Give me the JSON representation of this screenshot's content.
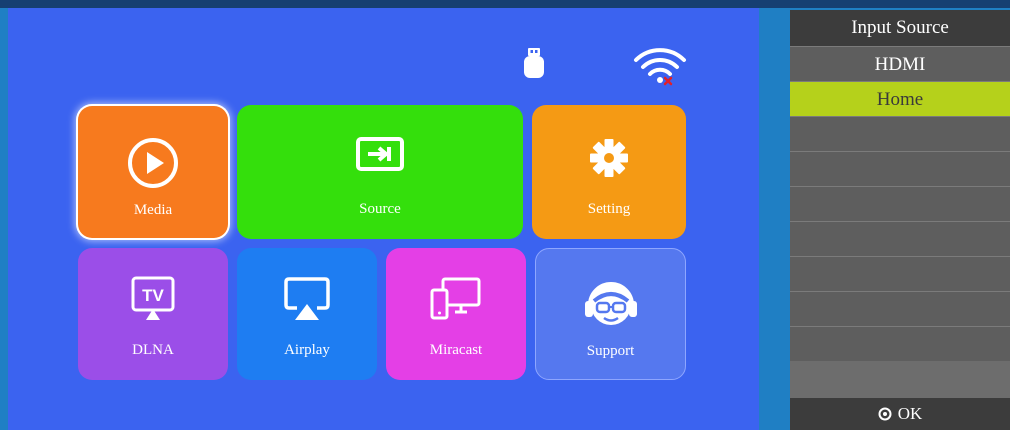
{
  "status_bar": {
    "usb_icon": "usb-drive-icon",
    "wifi_icon": "wifi-disconnected-icon",
    "wifi_alert_color": "#e0202a"
  },
  "tiles": [
    {
      "label": "Media",
      "icon": "play-icon",
      "color": "#f77a1e",
      "focused": true
    },
    {
      "label": "Source",
      "icon": "input-source-icon",
      "color": "#34df0c"
    },
    {
      "label": "Setting",
      "icon": "gear-icon",
      "color": "#f59a14"
    },
    {
      "label": "DLNA",
      "icon": "tv-cast-icon",
      "color": "#9b4ee8"
    },
    {
      "label": "Airplay",
      "icon": "airplay-icon",
      "color": "#1e7df2"
    },
    {
      "label": "Miracast",
      "icon": "devices-icon",
      "color": "#e43fe6"
    },
    {
      "label": "Support",
      "icon": "support-headset-icon",
      "color": "#5578ef"
    }
  ],
  "osd": {
    "title": "Input Source",
    "items": [
      {
        "label": "HDMI",
        "selected": false
      },
      {
        "label": "Home",
        "selected": true
      }
    ],
    "footer_label": "OK",
    "footer_icon": "ok-button-icon",
    "accent_color": "#b5d11b"
  }
}
